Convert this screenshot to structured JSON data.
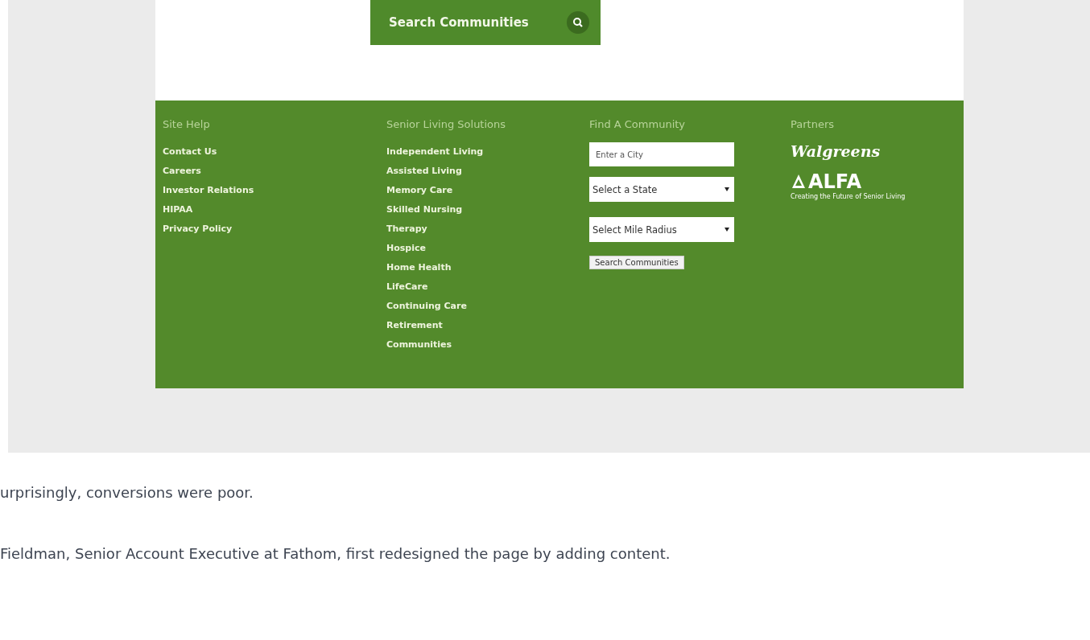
{
  "search_button": {
    "label": "Search Communities"
  },
  "footer": {
    "site_help": {
      "heading": "Site Help",
      "links": [
        "Contact Us",
        "Careers",
        "Investor Relations",
        "HIPAA",
        "Privacy Policy"
      ]
    },
    "senior_living": {
      "heading": "Senior Living Solutions",
      "links": [
        "Independent Living",
        "Assisted Living",
        "Memory Care",
        "Skilled Nursing",
        "Therapy",
        "Hospice",
        "Home Health",
        "LifeCare",
        "Continuing Care",
        "Retirement",
        "Communities"
      ]
    },
    "find_community": {
      "heading": "Find A Community",
      "city_placeholder": "Enter a City",
      "state_select": "Select a State",
      "radius_select": "Select Mile Radius",
      "button": "Search Communities"
    },
    "partners": {
      "heading": "Partners",
      "walgreens": "Walgreens",
      "alfa": "ALFA",
      "alfa_tagline": "Creating the Future of Senior Living"
    }
  },
  "article": [
    "urprisingly, conversions were poor.",
    "Fieldman, Senior Account Executive at Fathom, first redesigned the page by adding content."
  ]
}
